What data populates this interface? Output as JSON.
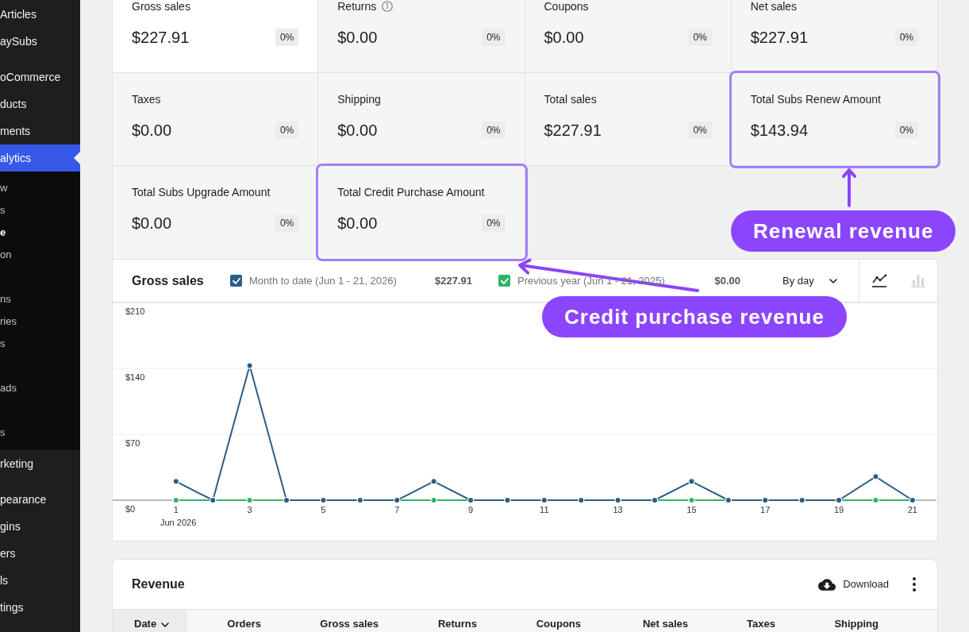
{
  "sidebar": {
    "groups": [
      {
        "items": [
          {
            "label": "Articles",
            "selected": false
          },
          {
            "label": "aySubs",
            "selected": false
          }
        ]
      },
      {
        "items": [
          {
            "label": "oCommerce",
            "selected": false
          },
          {
            "label": "ducts",
            "selected": false
          },
          {
            "label": "ments",
            "selected": false
          },
          {
            "label": "alytics",
            "selected": true,
            "submenu_groups": [
              {
                "items": [
                  {
                    "label": "w",
                    "selected": false
                  },
                  {
                    "label": "s",
                    "selected": false
                  },
                  {
                    "label": "e",
                    "selected": true
                  },
                  {
                    "label": "on",
                    "selected": false
                  }
                ]
              },
              {
                "items": [
                  {
                    "label": "ns",
                    "selected": false
                  },
                  {
                    "label": "ries",
                    "selected": false
                  },
                  {
                    "label": "s",
                    "selected": false
                  }
                ]
              },
              {
                "items": [
                  {
                    "label": "ads",
                    "selected": false
                  }
                ]
              },
              {
                "items": [
                  {
                    "label": "s",
                    "selected": false
                  }
                ]
              }
            ]
          },
          {
            "label": "rketing",
            "selected": false
          }
        ]
      },
      {
        "items": [
          {
            "label": "pearance",
            "selected": false
          },
          {
            "label": "gins",
            "selected": false
          },
          {
            "label": "ers",
            "selected": false
          },
          {
            "label": "ls",
            "selected": false
          },
          {
            "label": "tings",
            "selected": false
          }
        ]
      }
    ]
  },
  "cards": [
    {
      "label": "Gross sales",
      "value": "$227.91",
      "delta": "0%",
      "kind": "plain",
      "selected": true,
      "highlighted": false
    },
    {
      "label": "Returns",
      "value": "$0.00",
      "delta": "0%",
      "kind": "info",
      "selected": false,
      "highlighted": false
    },
    {
      "label": "Coupons",
      "value": "$0.00",
      "delta": "0%",
      "kind": "plain",
      "selected": false,
      "highlighted": false
    },
    {
      "label": "Net sales",
      "value": "$227.91",
      "delta": "0%",
      "kind": "plain",
      "selected": false,
      "highlighted": false
    },
    {
      "label": "Taxes",
      "value": "$0.00",
      "delta": "0%",
      "kind": "plain",
      "selected": false,
      "highlighted": false
    },
    {
      "label": "Shipping",
      "value": "$0.00",
      "delta": "0%",
      "kind": "plain",
      "selected": false,
      "highlighted": false
    },
    {
      "label": "Total sales",
      "value": "$227.91",
      "delta": "0%",
      "kind": "plain",
      "selected": false,
      "highlighted": false
    },
    {
      "label": "Total Subs Renew Amount",
      "value": "$143.94",
      "delta": "0%",
      "kind": "plain",
      "selected": false,
      "highlighted": true
    },
    {
      "label": "Total Subs Upgrade Amount",
      "value": "$0.00",
      "delta": "0%",
      "kind": "plain",
      "selected": false,
      "highlighted": false
    },
    {
      "label": "Total Credit Purchase Amount",
      "value": "$0.00",
      "delta": "0%",
      "kind": "plain",
      "selected": false,
      "highlighted": true
    }
  ],
  "chart": {
    "title": "Gross sales",
    "legend": [
      {
        "total": "$227.91",
        "checked": true
      },
      {
        "total": "$0.00",
        "checked": true
      }
    ],
    "interval": "By day",
    "view_toggles": [
      {
        "kind": "line",
        "selected": true
      },
      {
        "kind": "bar",
        "selected": false
      }
    ],
    "period_label": "Jun 2026",
    "chart_data": {
      "type": "line",
      "x": [
        1,
        2,
        3,
        4,
        5,
        6,
        7,
        8,
        9,
        10,
        11,
        12,
        13,
        14,
        15,
        16,
        17,
        18,
        19,
        20,
        21
      ],
      "xlim": [
        -0.72,
        21.65
      ],
      "xticks": [
        {
          "value": 1,
          "label": "1"
        },
        {
          "value": 3,
          "label": "3"
        },
        {
          "value": 5,
          "label": "5"
        },
        {
          "value": 7,
          "label": "7"
        },
        {
          "value": 9,
          "label": "9"
        },
        {
          "value": 11,
          "label": "11"
        },
        {
          "value": 13,
          "label": "13"
        },
        {
          "value": 15,
          "label": "15"
        },
        {
          "value": 17,
          "label": "17"
        },
        {
          "value": 19,
          "label": "19"
        },
        {
          "value": 21,
          "label": "21"
        }
      ],
      "ylim": [
        0,
        210
      ],
      "yticks": [
        {
          "value": 0,
          "label": "$0"
        },
        {
          "value": 70,
          "label": "$70"
        },
        {
          "value": 140,
          "label": "$140"
        },
        {
          "value": 210,
          "label": "$210"
        }
      ],
      "series": [
        {
          "name": "Month to date (Jun 1 - 21, 2026)",
          "color": "#2b5d87",
          "marker": "circle",
          "values": [
            20,
            0,
            143,
            0,
            0,
            0,
            0,
            20,
            0,
            0,
            0,
            0,
            0,
            0,
            20,
            0,
            0,
            0,
            0,
            25,
            0
          ]
        },
        {
          "name": "Previous year (Jun 1 - 21, 2025)",
          "color": "#2fb36b",
          "marker": "circle",
          "values": [
            0,
            0,
            0,
            0,
            0,
            0,
            0,
            0,
            0,
            0,
            0,
            0,
            0,
            0,
            0,
            0,
            0,
            0,
            0,
            0,
            0
          ]
        }
      ]
    }
  },
  "revenue": {
    "title": "Revenue",
    "download": "Download",
    "columns": [
      {
        "label": "Date",
        "sorted": true
      },
      {
        "label": "Orders",
        "sorted": false
      },
      {
        "label": "Gross sales",
        "sorted": false
      },
      {
        "label": "Returns",
        "sorted": false
      },
      {
        "label": "Coupons",
        "sorted": false
      },
      {
        "label": "Net sales",
        "sorted": false
      },
      {
        "label": "Taxes",
        "sorted": false
      },
      {
        "label": "Shipping",
        "sorted": false
      }
    ]
  },
  "annotations": [
    {
      "label": "Renewal revenue"
    },
    {
      "label": "Credit purchase revenue"
    }
  ]
}
